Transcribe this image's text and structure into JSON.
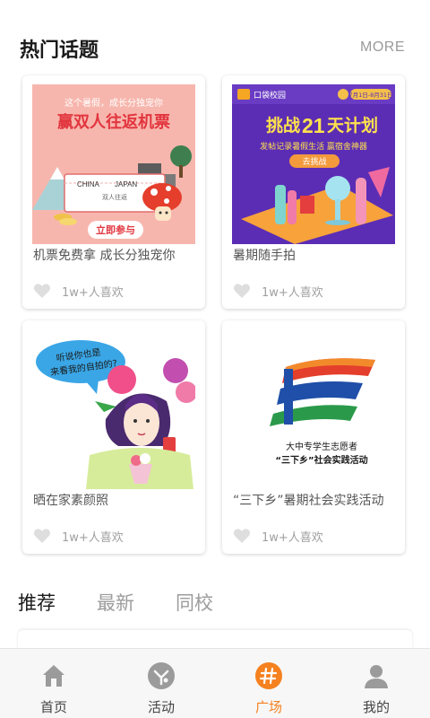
{
  "header": {
    "title": "热门话题",
    "more_label": "MORE"
  },
  "cards": [
    {
      "caption": "机票免费拿 成长分独宠你",
      "likes": "1w+人喜欢",
      "banner": {
        "top": "这个暑假，成长分独宠你",
        "headline": "赢双人往返机票",
        "ticket_from": "CHINA",
        "ticket_to": "JAPAN",
        "ticket_sub": "双人往返",
        "cta": "立即参与"
      }
    },
    {
      "caption": "暑期随手拍",
      "likes": "1w+人喜欢",
      "banner": {
        "brand": "口袋校园",
        "date": "7月1日-8月31日",
        "headline_pre": "挑战",
        "headline_num": "21",
        "headline_post": "天计划",
        "sub": "发帖记录暑假生活  赢宿舍神器",
        "cta": "去挑战"
      }
    },
    {
      "caption": "晒在家素颜照",
      "likes": "1w+人喜欢",
      "banner": {
        "bubble_line1": "听说你也是",
        "bubble_line2": "来看我的自拍的?"
      }
    },
    {
      "caption": "“三下乡”暑期社会实践活动",
      "likes": "1w+人喜欢",
      "banner": {
        "line1": "大中专学生志愿者",
        "line2": "“三下乡”社会实践活动"
      }
    }
  ],
  "tabs": [
    {
      "label": "推荐",
      "active": true
    },
    {
      "label": "最新",
      "active": false
    },
    {
      "label": "同校",
      "active": false
    }
  ],
  "bottom_nav": [
    {
      "label": "首页",
      "icon": "home-icon"
    },
    {
      "label": "活动",
      "icon": "activity-icon"
    },
    {
      "label": "广场",
      "icon": "hashtag-icon",
      "active": true
    },
    {
      "label": "我的",
      "icon": "profile-icon"
    }
  ],
  "colors": {
    "accent": "#f5811f",
    "banner1_bg": "#f7b6ad",
    "banner2_bg": "#5b2db5",
    "inactive": "#9c9c9c"
  }
}
